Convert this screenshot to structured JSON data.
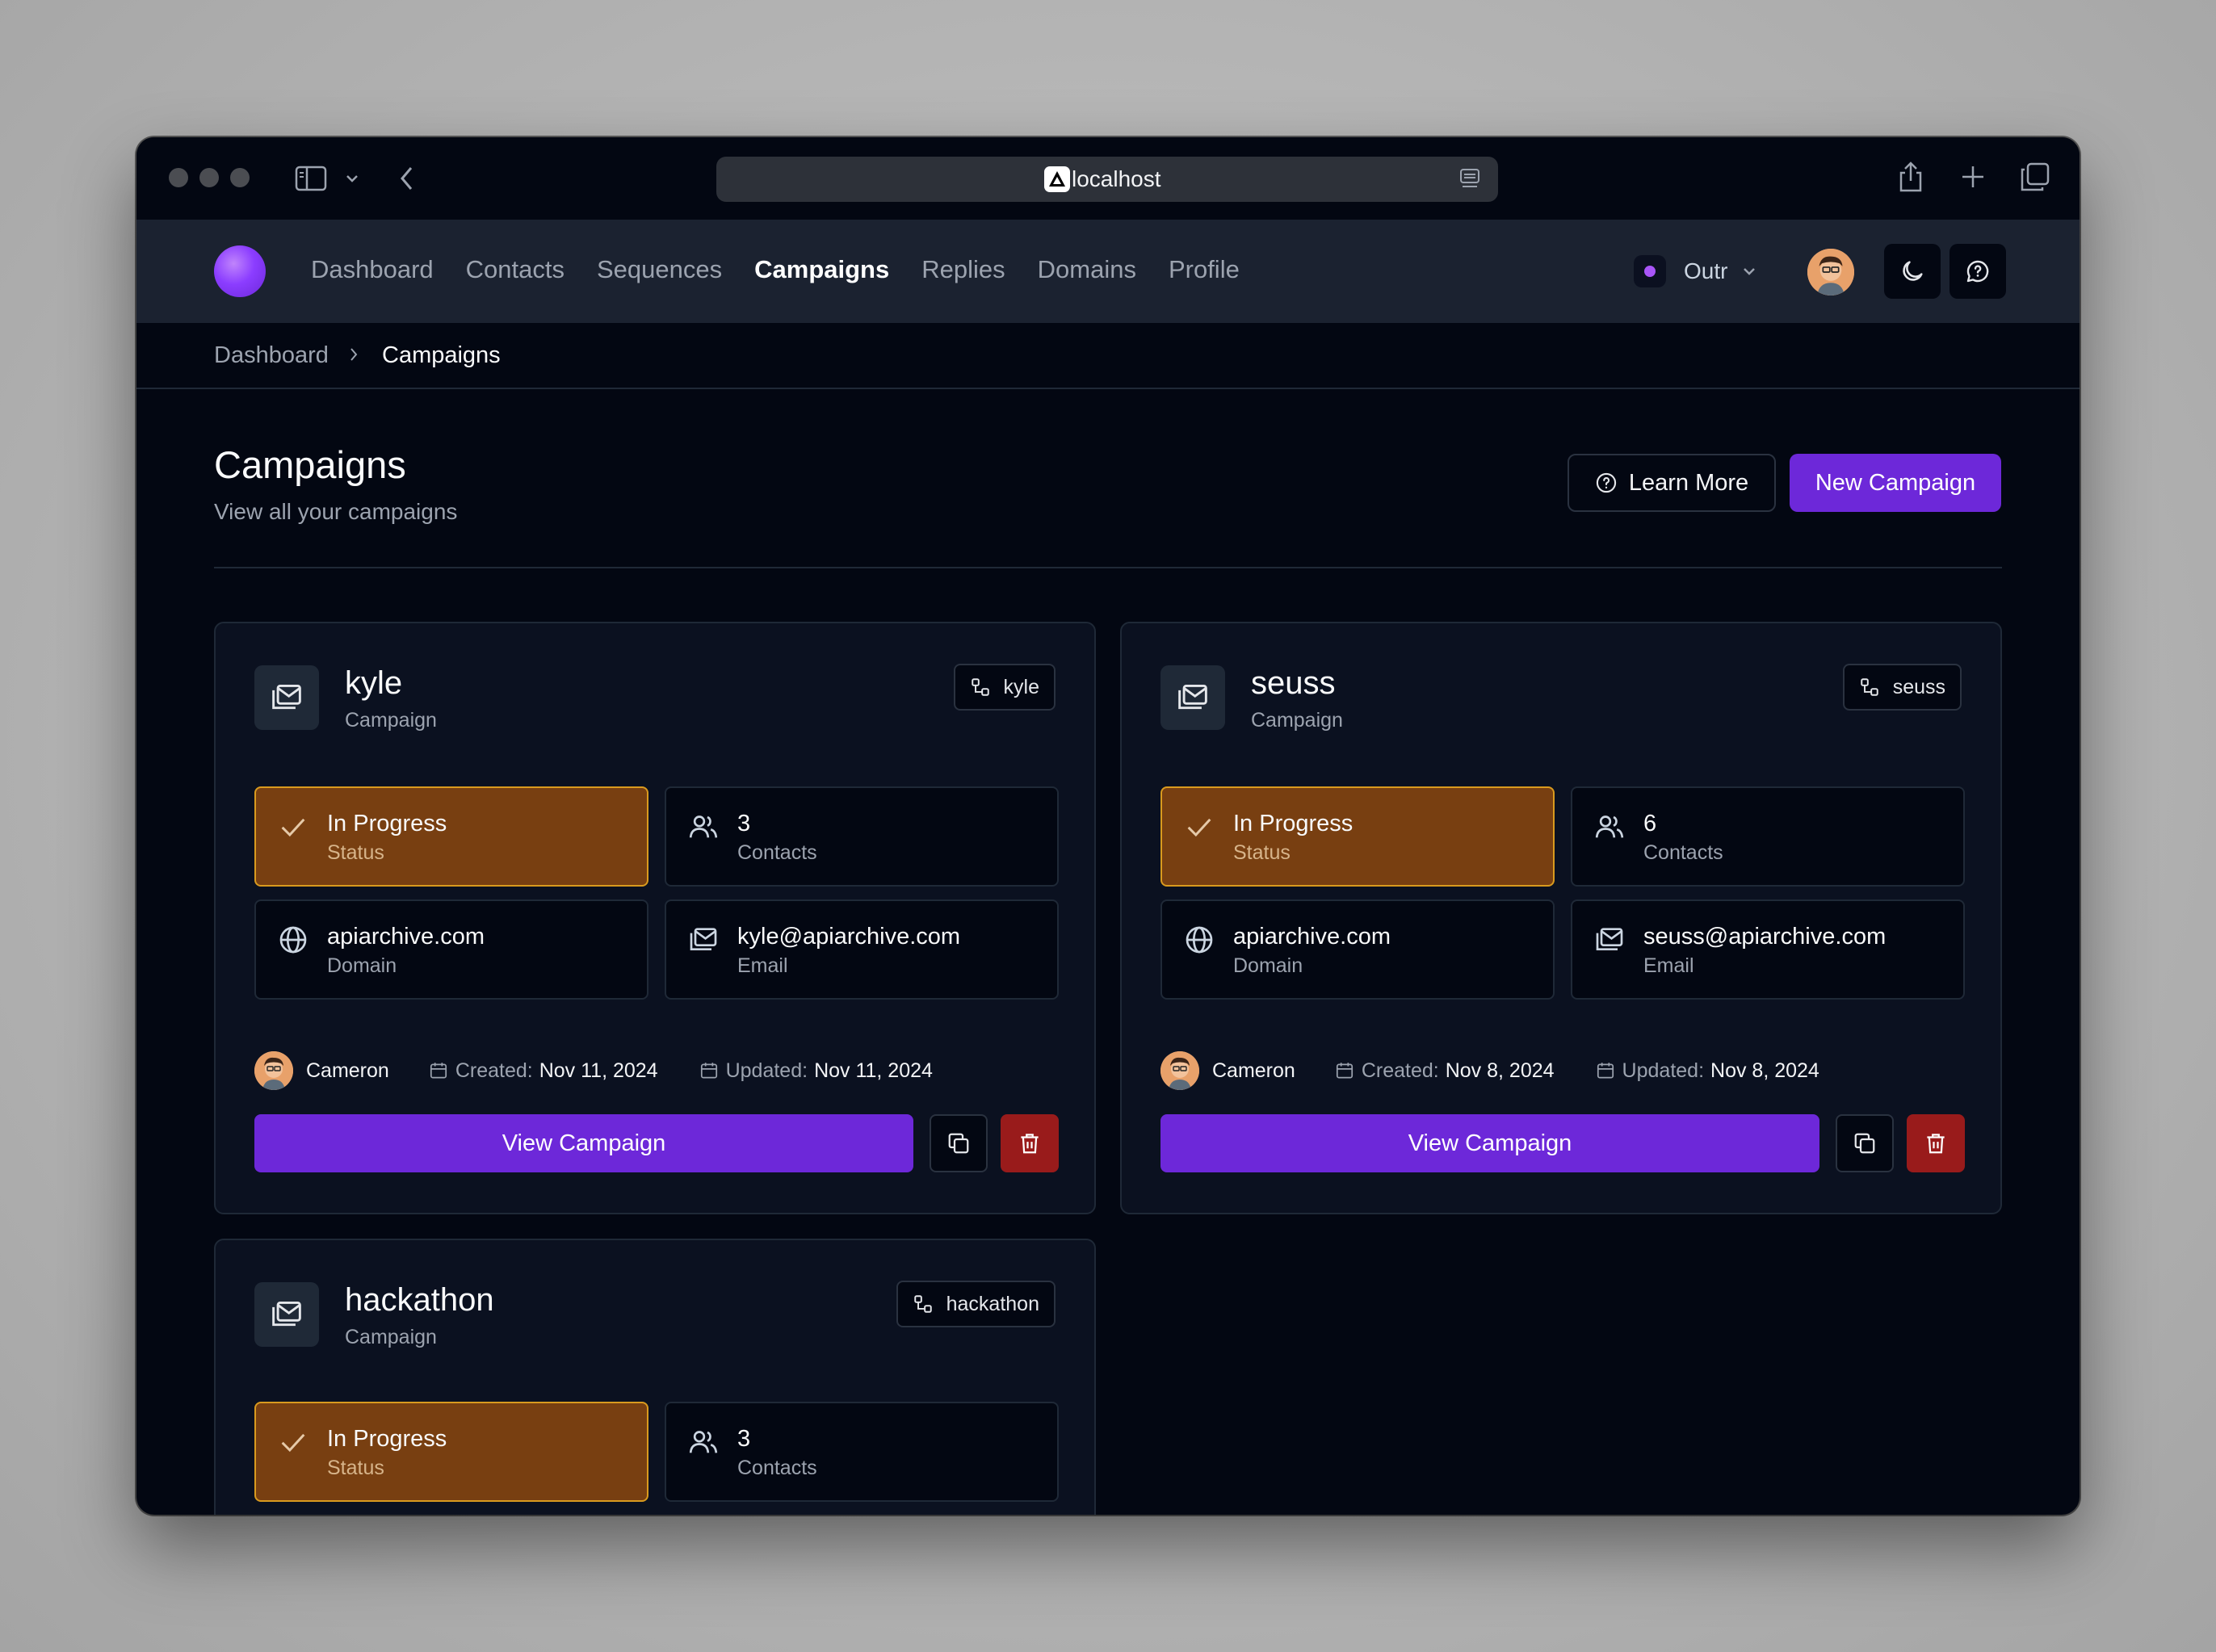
{
  "browser": {
    "url": "localhost"
  },
  "nav": {
    "items": [
      "Dashboard",
      "Contacts",
      "Sequences",
      "Campaigns",
      "Replies",
      "Domains",
      "Profile"
    ],
    "active": "Campaigns",
    "workspace": "Outr"
  },
  "breadcrumb": {
    "items": [
      "Dashboard",
      "Campaigns"
    ]
  },
  "header": {
    "title": "Campaigns",
    "subtitle": "View all your campaigns",
    "learn_more": "Learn More",
    "new_campaign": "New Campaign"
  },
  "campaigns": [
    {
      "name": "kyle",
      "type": "Campaign",
      "tag": "kyle",
      "status": "In Progress",
      "status_label": "Status",
      "contacts": "3",
      "contacts_label": "Contacts",
      "domain": "apiarchive.com",
      "domain_label": "Domain",
      "email": "kyle@apiarchive.com",
      "email_label": "Email",
      "owner": "Cameron",
      "created_label": "Created:",
      "created": "Nov 11, 2024",
      "updated_label": "Updated:",
      "updated": "Nov 11, 2024",
      "view_label": "View Campaign"
    },
    {
      "name": "seuss",
      "type": "Campaign",
      "tag": "seuss",
      "status": "In Progress",
      "status_label": "Status",
      "contacts": "6",
      "contacts_label": "Contacts",
      "domain": "apiarchive.com",
      "domain_label": "Domain",
      "email": "seuss@apiarchive.com",
      "email_label": "Email",
      "owner": "Cameron",
      "created_label": "Created:",
      "created": "Nov 8, 2024",
      "updated_label": "Updated:",
      "updated": "Nov 8, 2024",
      "view_label": "View Campaign"
    },
    {
      "name": "hackathon",
      "type": "Campaign",
      "tag": "hackathon",
      "status": "In Progress",
      "status_label": "Status",
      "contacts": "3",
      "contacts_label": "Contacts"
    }
  ],
  "colors": {
    "accent": "#6d28d9",
    "status_bg": "#783f11",
    "status_border": "#d99a1e",
    "danger": "#991b1b"
  }
}
